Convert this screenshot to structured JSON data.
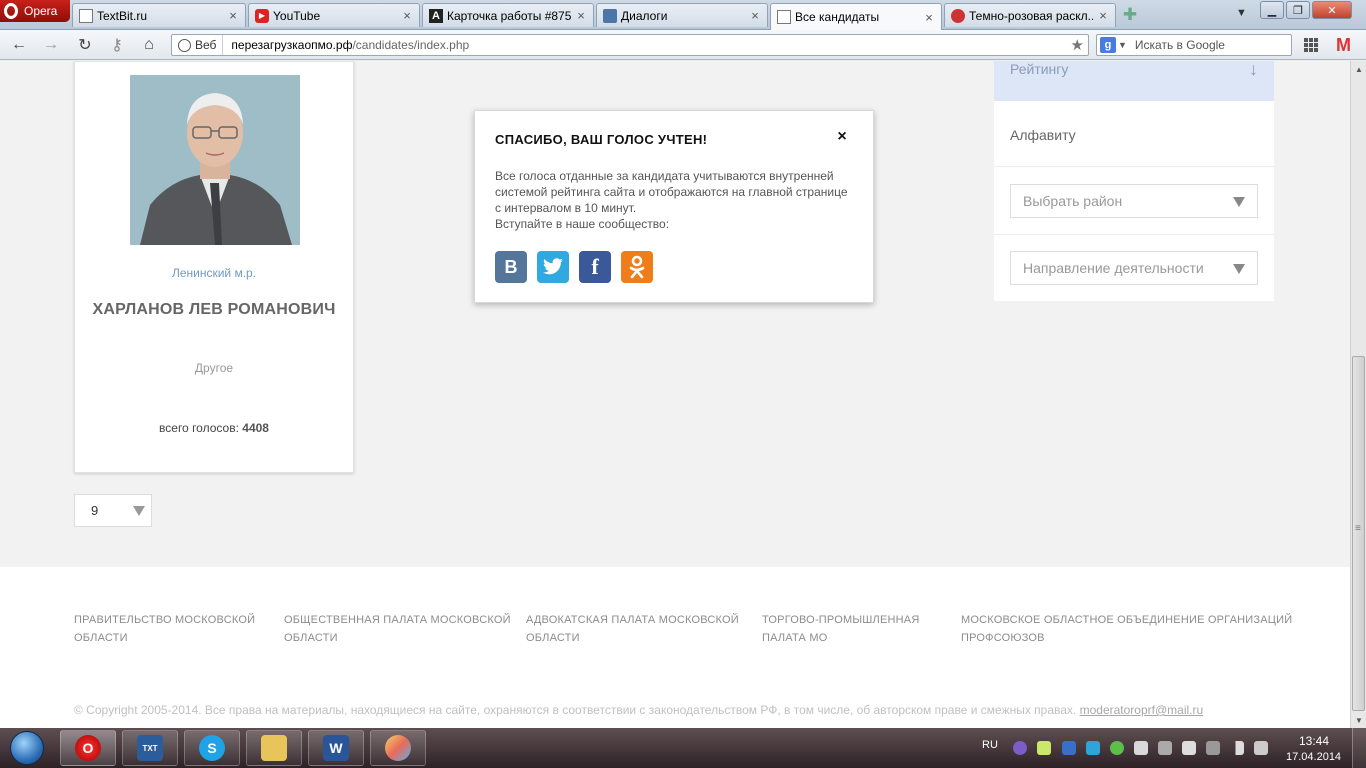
{
  "browser": {
    "menu_label": "Opera",
    "tabs": [
      {
        "label": "TextBit.ru",
        "icon": "page-icon"
      },
      {
        "label": "YouTube",
        "icon": "youtube-icon"
      },
      {
        "label": "Карточка работы #875...",
        "icon": "advego-icon"
      },
      {
        "label": "Диалоги",
        "icon": "chat-icon"
      },
      {
        "label": "Все кандидаты",
        "icon": "page-icon",
        "active": true
      },
      {
        "label": "Темно-розовая раскл...",
        "icon": "site-icon"
      }
    ],
    "address": {
      "badge": "Веб",
      "url_host": "перезагрузкаопмо.рф",
      "url_path": "/candidates/index.php"
    },
    "search_placeholder": "Искать в Google",
    "google_letter": "g",
    "gmail_letter": "M"
  },
  "candidate": {
    "district": "Ленинский м.р.",
    "name": "ХАРЛАНОВ ЛЕВ РОМАНОВИЧ",
    "category": "Другое",
    "votes_label": "всего голосов:",
    "votes_value": "4408"
  },
  "pagination": {
    "per_page": "9"
  },
  "sidebar": {
    "sort_rating": "Рейтингу",
    "sort_alpha": "Алфавиту",
    "district_select": "Выбрать район",
    "activity_select": "Направление деятельности"
  },
  "modal": {
    "title": "СПАСИБО, ВАШ ГОЛОС УЧТЕН!",
    "close": "×",
    "text": "Все голоса отданные за кандидата учитываются внутренней системой рейтинга сайта и отображаются на главной странице с интервалом в 10 минут.",
    "join_text": "Вступайте в наше сообщество:",
    "social": {
      "vk": "В",
      "twitter": "t",
      "facebook": "f",
      "ok": "ok"
    }
  },
  "footer": {
    "links": [
      {
        "line1": "ПРАВИТЕЛЬСТВО МОСКОВСКОЙ",
        "line2": "ОБЛАСТИ"
      },
      {
        "line1": "ОБЩЕСТВЕННАЯ ПАЛАТА МОСКОВСКОЙ",
        "line2": "ОБЛАСТИ"
      },
      {
        "line1": "АДВОКАТСКАЯ ПАЛАТА МОСКОВСКОЙ",
        "line2": "ОБЛАСТИ"
      },
      {
        "line1": "ТОРГОВО-ПРОМЫШЛЕННАЯ",
        "line2": "ПАЛАТА МО"
      },
      {
        "line1": "МОСКОВСКОЕ ОБЛАСТНОЕ ОБЪЕДИНЕНИЕ ОРГАНИЗАЦИЙ",
        "line2": "ПРОФСОЮЗОВ"
      }
    ],
    "copyright": "© Copyright 2005-2014. Все права на материалы, находящиеся на сайте, охраняются в соответствии с законодательством РФ, в том числе, об авторском праве и смежных правах.",
    "email": "moderatoroprf@mail.ru"
  },
  "taskbar": {
    "language": "RU",
    "time": "13:44",
    "date": "17.04.2014",
    "apps": [
      "opera-icon",
      "textru-icon",
      "skype-icon",
      "explorer-icon",
      "word-icon",
      "paint-icon"
    ]
  },
  "colors": {
    "accent_blue": "#6e9bc3",
    "sort_active_bg": "#dde6f6",
    "vk": "#54769a",
    "twitter": "#2fa9e0",
    "facebook": "#3b5998",
    "odnoklassniki": "#ef7d1a"
  }
}
